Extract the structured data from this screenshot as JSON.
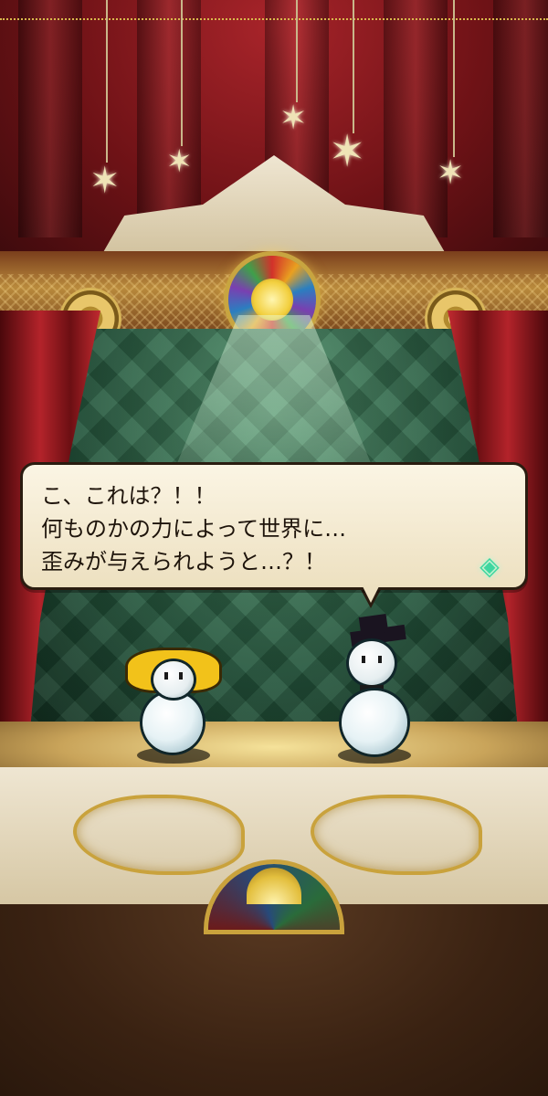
{
  "dialog": {
    "lines": [
      "こ、これは？！！",
      "何ものかの力によって世界に…",
      "歪みが与えられようと…？！"
    ],
    "next_indicator_icon": "green-crystal-icon"
  },
  "scene": {
    "characters": [
      "blonde-snowman",
      "top-hat-snowman"
    ],
    "colors": {
      "curtain": "#b3232a",
      "stage_wall": "#25563d",
      "gold": "#c9a23c",
      "dialog_bg": "#fbf5e4"
    }
  }
}
